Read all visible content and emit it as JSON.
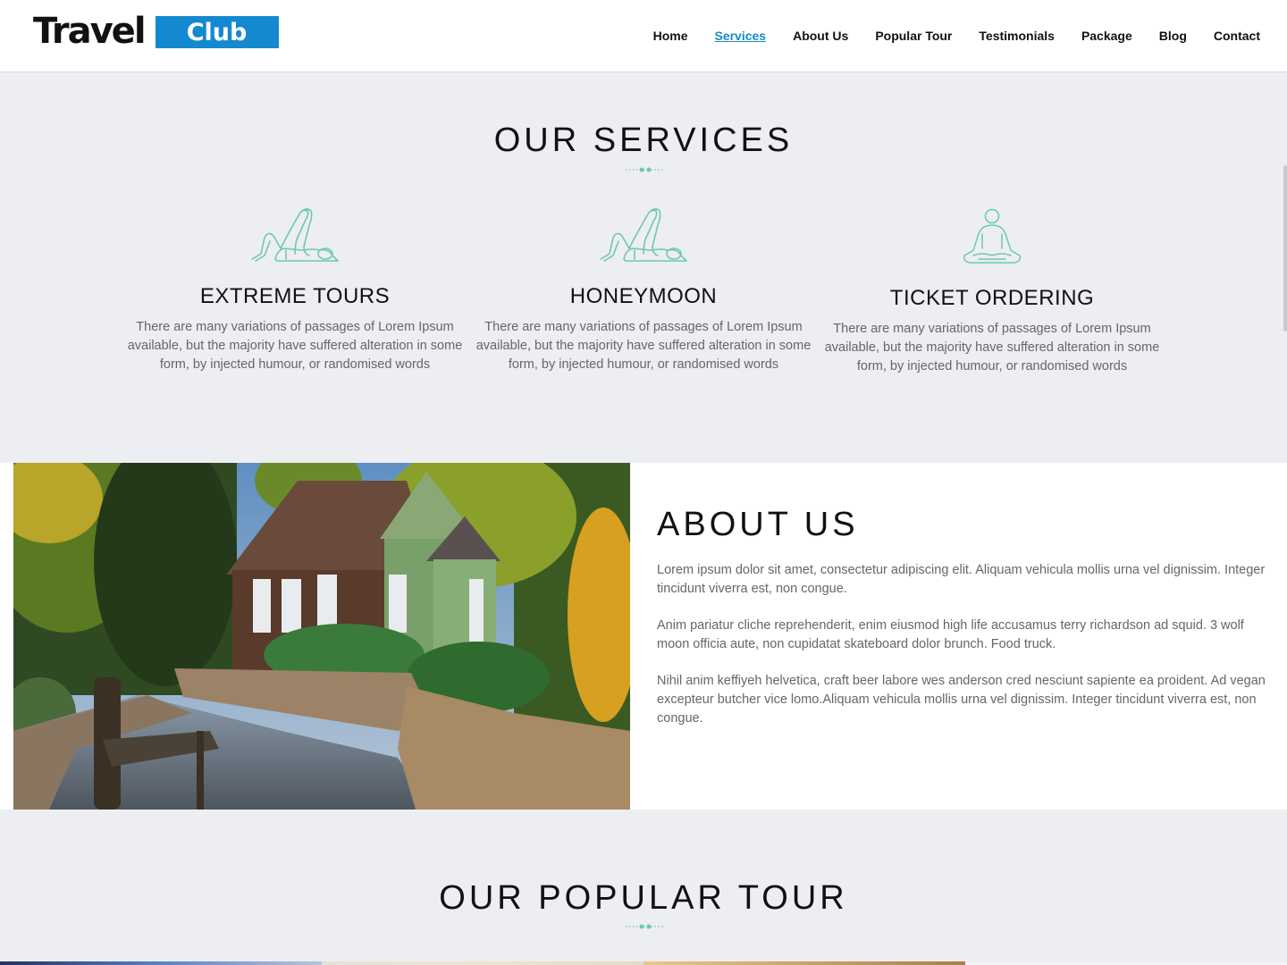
{
  "header": {
    "logo": {
      "word1": "Travel",
      "word2": "Club"
    },
    "nav": [
      {
        "label": "Home",
        "active": false
      },
      {
        "label": "Services",
        "active": true
      },
      {
        "label": "About Us",
        "active": false
      },
      {
        "label": "Popular Tour",
        "active": false
      },
      {
        "label": "Testimonials",
        "active": false
      },
      {
        "label": "Package",
        "active": false
      },
      {
        "label": "Blog",
        "active": false
      },
      {
        "label": "Contact",
        "active": false
      }
    ]
  },
  "colors": {
    "brand_blue": "#1489d0",
    "active_link": "#1a8bc0",
    "accent_teal": "#6ccaa9",
    "page_bg": "#edeef2"
  },
  "services": {
    "title": "OUR SERVICES",
    "items": [
      {
        "icon": "reclining-figure-icon",
        "title": "EXTREME TOURS",
        "text": "There are many variations of passages of Lorem Ipsum available, but the majority have suffered alteration in some form, by injected humour, or randomised words"
      },
      {
        "icon": "reclining-figure-icon",
        "title": "HONEYMOON",
        "text": "There are many variations of passages of Lorem Ipsum available, but the majority have suffered alteration in some form, by injected humour, or randomised words"
      },
      {
        "icon": "meditation-icon",
        "title": "TICKET ORDERING",
        "text": "There are many variations of passages of Lorem Ipsum available, but the majority have suffered alteration in some form, by injected humour, or randomised words"
      }
    ]
  },
  "about": {
    "title": "ABOUT US",
    "image_alt": "Cabin with stone garden walls and wooden bench",
    "paragraphs": [
      "Lorem ipsum dolor sit amet, consectetur adipiscing elit. Aliquam vehicula mollis urna vel dignissim. Integer tincidunt viverra est, non congue.",
      "Anim pariatur cliche reprehenderit, enim eiusmod high life accusamus terry richardson ad squid. 3 wolf moon officia aute, non cupidatat skateboard dolor brunch. Food truck.",
      "Nihil anim keffiyeh helvetica, craft beer labore wes anderson cred nesciunt sapiente ea proident. Ad vegan excepteur butcher vice lomo.Aliquam vehicula mollis urna vel dignissim. Integer tincidunt viverra est, non congue."
    ]
  },
  "popular_tour": {
    "title": "OUR POPULAR TOUR"
  }
}
